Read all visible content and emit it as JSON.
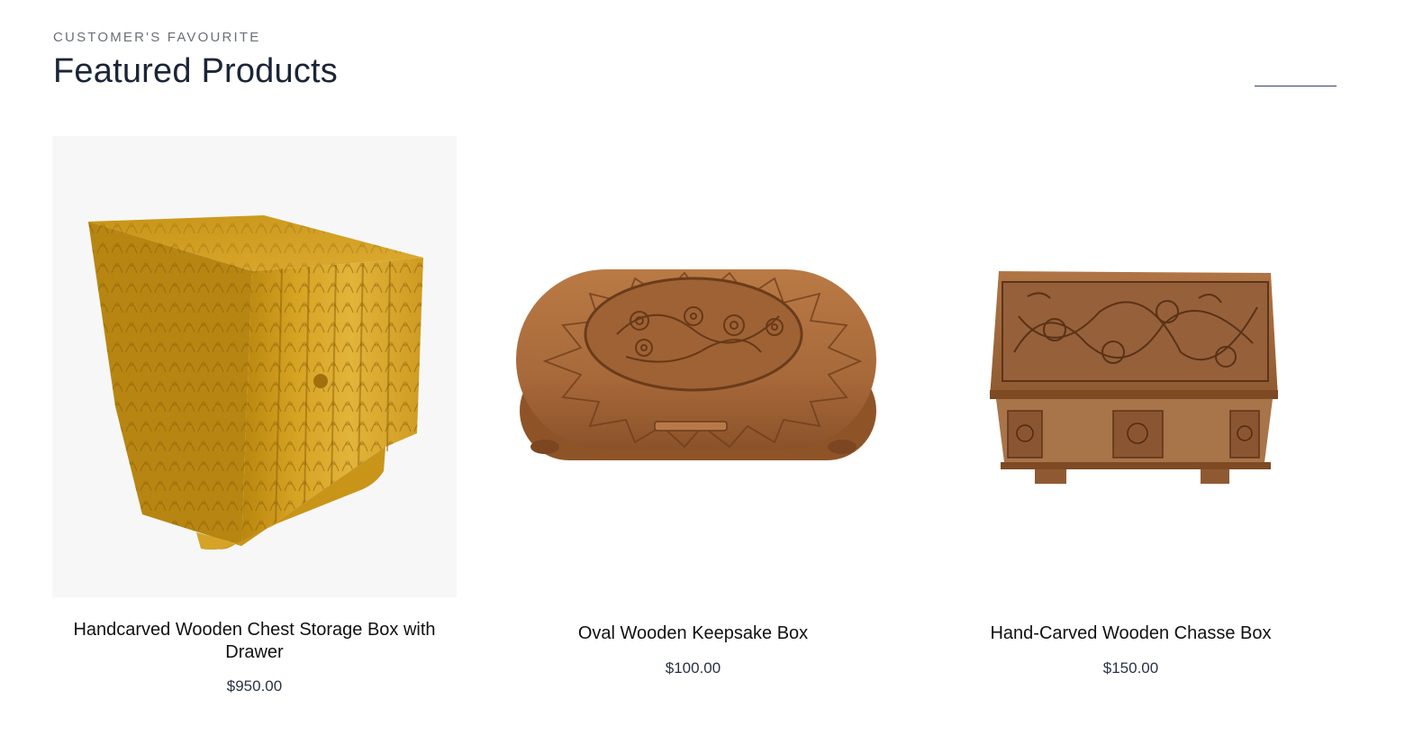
{
  "section": {
    "eyebrow": "CUSTOMER'S FAVOURITE",
    "title": "Featured Products"
  },
  "products": [
    {
      "name": "Handcarved Wooden Chest Storage Box with Drawer",
      "price": "$950.00",
      "image_icon": "carved-chest-image"
    },
    {
      "name": "Oval Wooden Keepsake Box",
      "price": "$100.00",
      "image_icon": "oval-box-image"
    },
    {
      "name": "Hand-Carved Wooden Chasse Box",
      "price": "$150.00",
      "image_icon": "chasse-box-image"
    }
  ],
  "colors": {
    "heading": "#1b2537",
    "eyebrow": "#6b6f76",
    "price": "#2a3345",
    "gold_wood": "#c9961f",
    "walnut_wood": "#a8693a"
  }
}
